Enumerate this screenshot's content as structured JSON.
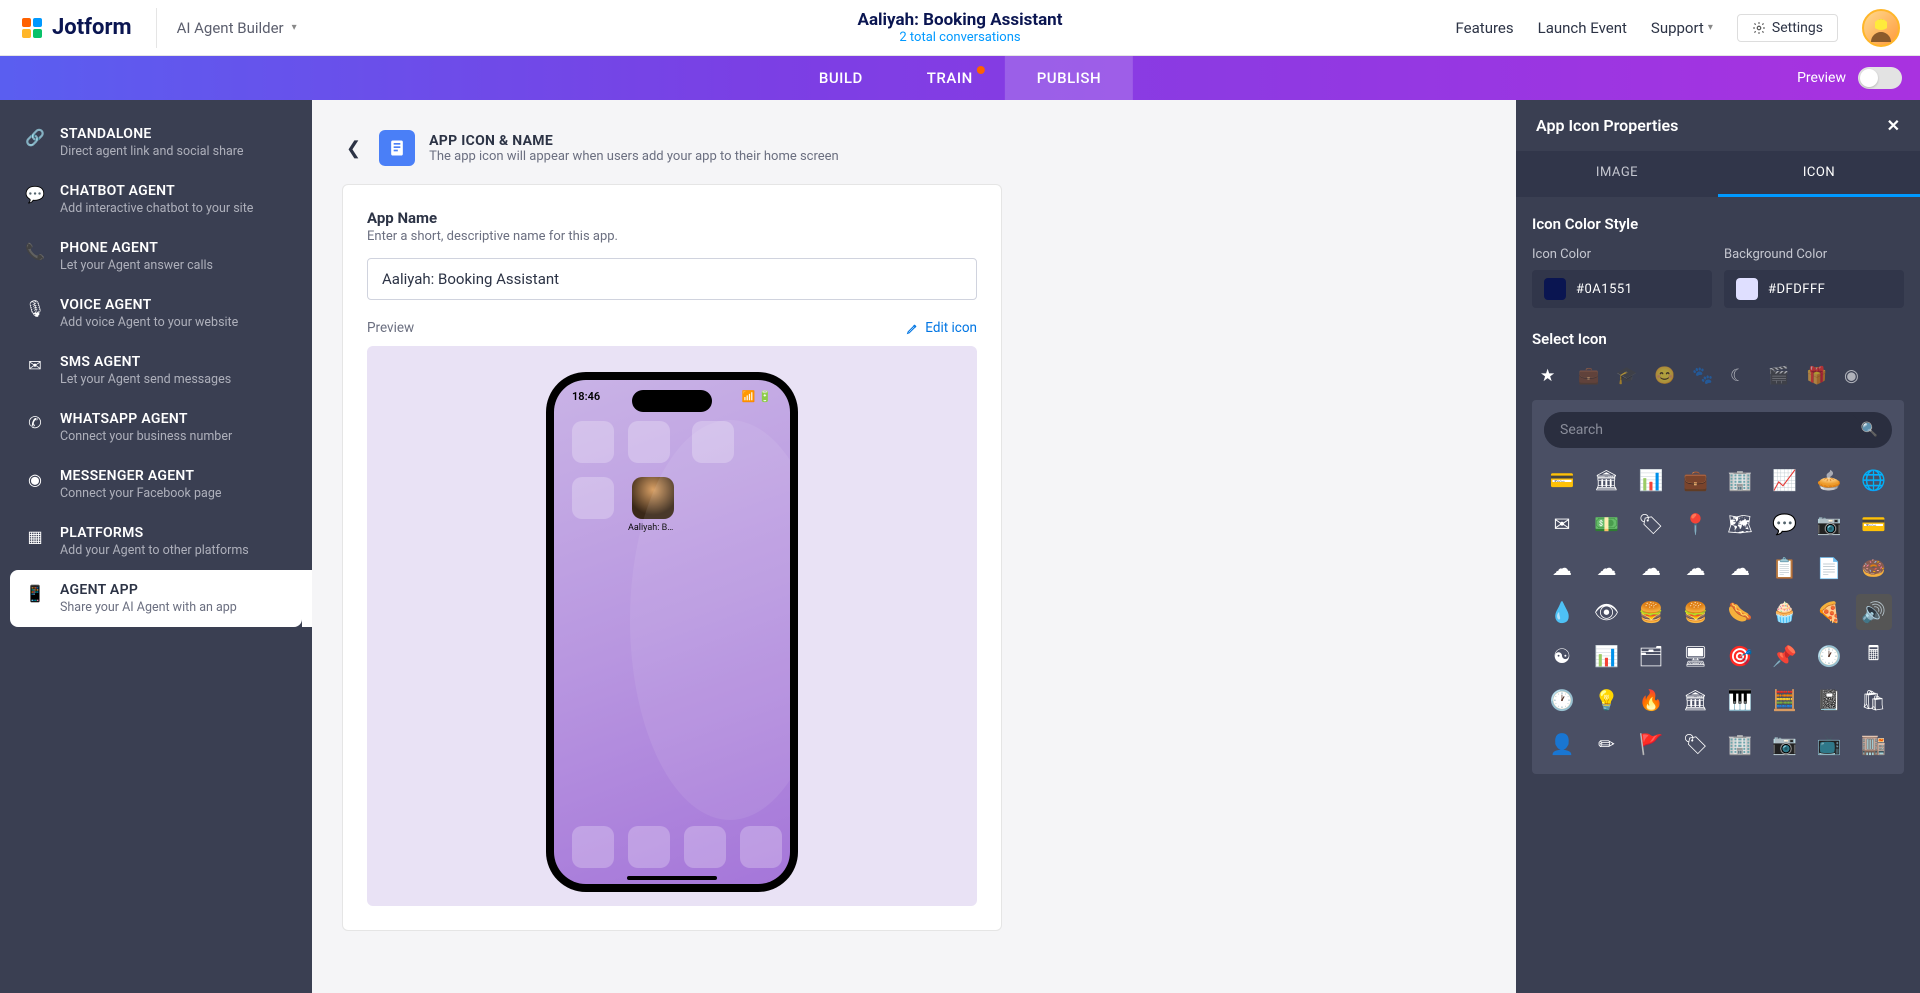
{
  "header": {
    "logo_text": "Jotform",
    "subtitle": "AI Agent Builder",
    "title": "Aaliyah: Booking Assistant",
    "conversations": "2 total conversations",
    "links": {
      "features": "Features",
      "launch": "Launch Event",
      "support": "Support",
      "settings": "Settings"
    }
  },
  "tabs": {
    "build": "BUILD",
    "train": "TRAIN",
    "publish": "PUBLISH",
    "preview": "Preview"
  },
  "sidebar": [
    {
      "title": "STANDALONE",
      "desc": "Direct agent link and social share",
      "icon": "🔗"
    },
    {
      "title": "CHATBOT AGENT",
      "desc": "Add interactive chatbot to your site",
      "icon": "💬"
    },
    {
      "title": "PHONE AGENT",
      "desc": "Let your Agent answer calls",
      "icon": "📞"
    },
    {
      "title": "VOICE AGENT",
      "desc": "Add voice Agent to your website",
      "icon": "🎙"
    },
    {
      "title": "SMS AGENT",
      "desc": "Let your Agent send messages",
      "icon": "✉"
    },
    {
      "title": "WHATSAPP AGENT",
      "desc": "Connect your business number",
      "icon": "✆"
    },
    {
      "title": "MESSENGER AGENT",
      "desc": "Connect your Facebook page",
      "icon": "◉"
    },
    {
      "title": "PLATFORMS",
      "desc": "Add your Agent to other platforms",
      "icon": "▦"
    },
    {
      "title": "AGENT APP",
      "desc": "Share your AI Agent with an app",
      "icon": "📱",
      "active": true
    }
  ],
  "center": {
    "crumb_title": "APP ICON & NAME",
    "crumb_desc": "The app icon will appear when users add your app to their home screen",
    "app_name_label": "App Name",
    "app_name_desc": "Enter a short, descriptive name for this app.",
    "app_name_value": "Aaliyah: Booking Assistant",
    "preview_label": "Preview",
    "edit_icon": "Edit icon",
    "phone_time": "18:46",
    "phone_app_label": "Aaliyah: Bo…"
  },
  "panel": {
    "title": "App Icon Properties",
    "tab_image": "IMAGE",
    "tab_icon": "ICON",
    "section_color": "Icon Color Style",
    "icon_color_label": "Icon Color",
    "bg_color_label": "Background Color",
    "icon_color": "#0A1551",
    "bg_color": "#DFDFFF",
    "select_icon": "Select Icon",
    "search_placeholder": "Search",
    "categories": [
      "★",
      "💼",
      "🎓",
      "😊",
      "🐾",
      "☾",
      "🎬",
      "🎁",
      "◉"
    ],
    "icons": [
      "💳",
      "🏛",
      "📊",
      "💼",
      "🏢",
      "📈",
      "🥧",
      "🌐",
      "✉",
      "💵",
      "🏷",
      "📍",
      "🗺",
      "💬",
      "📷",
      "💳",
      "☁",
      "☁",
      "☁",
      "☁",
      "☁",
      "📋",
      "📄",
      "🍩",
      "💧",
      "👁",
      "🍔",
      "🍔",
      "🌭",
      "🧁",
      "🍕",
      "🔊",
      "☯",
      "📊",
      "🗂",
      "🖥",
      "🎯",
      "📌",
      "🕐",
      "🖩",
      "🕐",
      "💡",
      "🔥",
      "🏛",
      "🎹",
      "🧮",
      "📓",
      "🛍",
      "👤",
      "✏",
      "🚩",
      "🏷",
      "🏢",
      "📷",
      "📺",
      "🏬"
    ]
  }
}
